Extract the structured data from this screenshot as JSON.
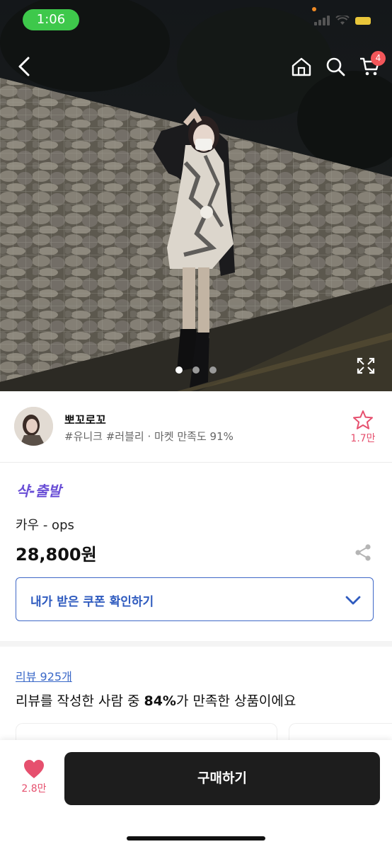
{
  "status_bar": {
    "time": "1:06"
  },
  "header": {
    "cart_count": "4",
    "icons": [
      "back-icon",
      "home-icon",
      "search-icon",
      "cart-icon"
    ]
  },
  "gallery": {
    "image_count": 3,
    "active_index": 0
  },
  "seller": {
    "name": "뽀꼬로꼬",
    "tags": "#유니크 #러블리 · 마켓 만족도 91%",
    "favorite_count": "1.7만"
  },
  "product": {
    "shipping_label": "샥-출발",
    "name": "카우 - ops",
    "price": "28,800원"
  },
  "coupon": {
    "label": "내가 받은 쿠폰 확인하기"
  },
  "reviews": {
    "link": "리뷰 925개",
    "summary_prefix": "리뷰를 작성한 사람 중 ",
    "summary_percent": "84%",
    "summary_suffix": "가 만족한 상품이에요"
  },
  "bottom_bar": {
    "like_count": "2.8만",
    "buy_label": "구매하기"
  },
  "colors": {
    "accent_pink": "#e6506e",
    "accent_blue": "#3f68c7",
    "shipping_purple": "#6a4fd6",
    "buy_button": "#1d1d1d"
  }
}
